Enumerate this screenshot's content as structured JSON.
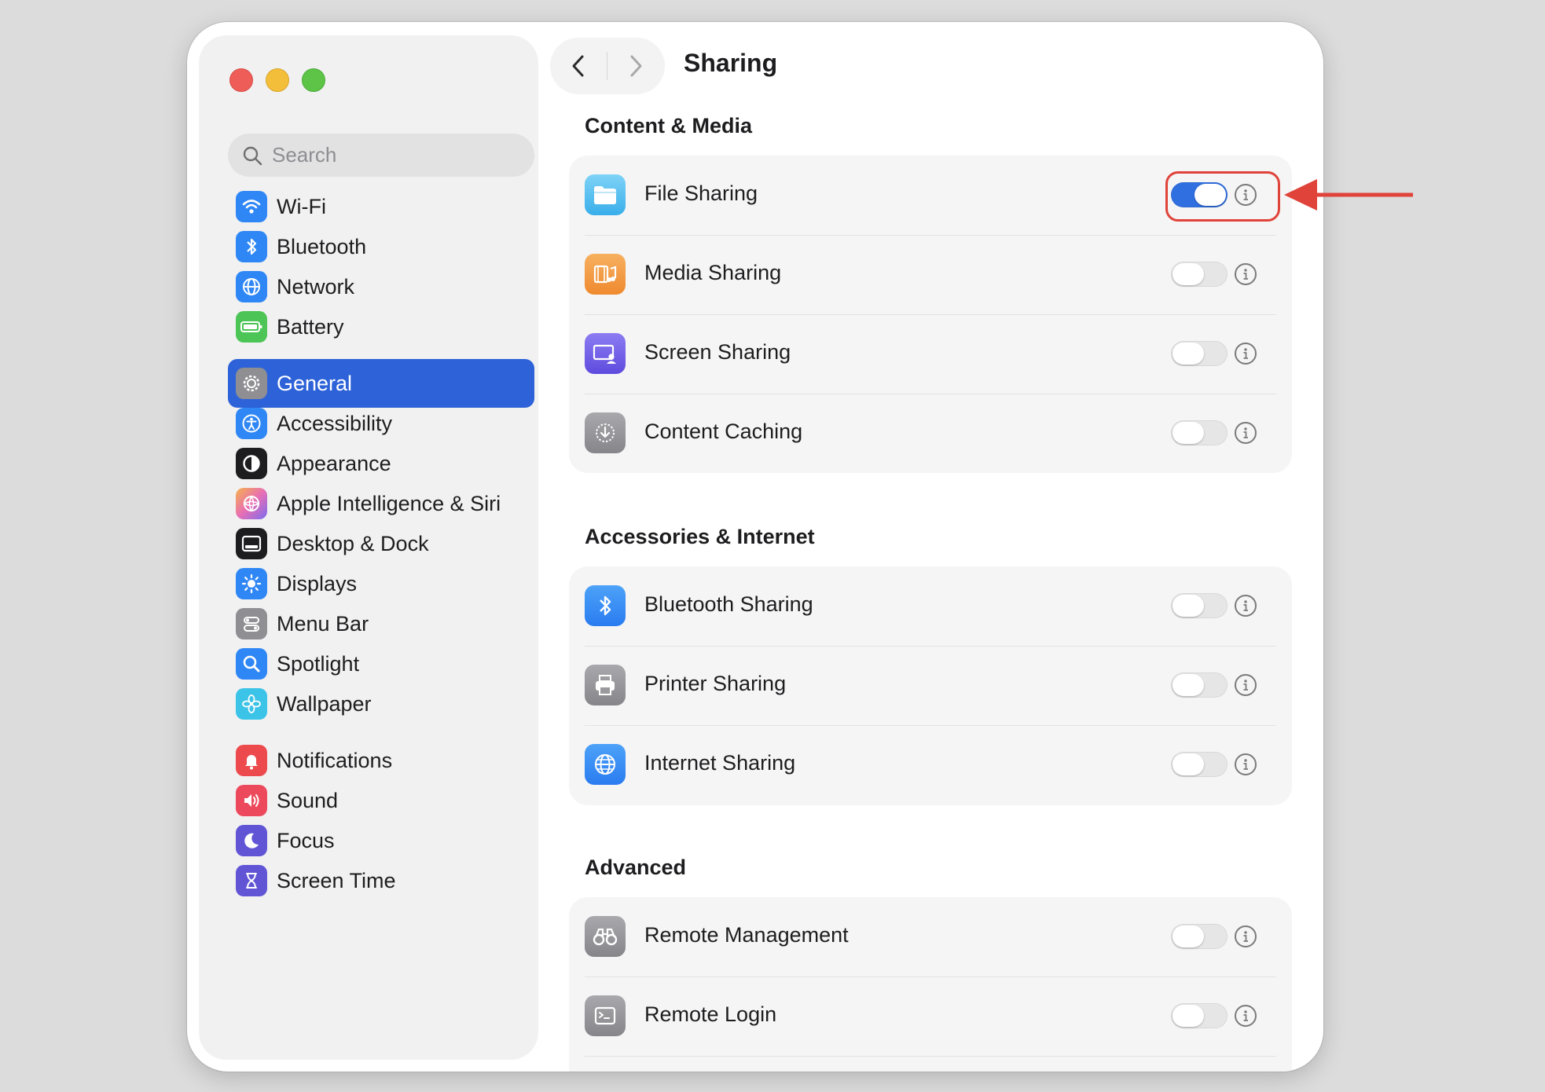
{
  "window": {
    "title": "Sharing"
  },
  "sidebar": {
    "search_placeholder": "Search",
    "items": [
      {
        "label": "Wi-Fi",
        "icon": "wifi-icon",
        "color": "#2f87f5"
      },
      {
        "label": "Bluetooth",
        "icon": "bluetooth-icon",
        "color": "#2f87f5"
      },
      {
        "label": "Network",
        "icon": "globe-icon",
        "color": "#2f87f5"
      },
      {
        "label": "Battery",
        "icon": "battery-icon",
        "color": "#4cc556"
      },
      {
        "label": "General",
        "icon": "gear-icon",
        "color": "#8e8e93",
        "selected": true
      },
      {
        "label": "Accessibility",
        "icon": "accessibility-icon",
        "color": "#2f87f5"
      },
      {
        "label": "Appearance",
        "icon": "appearance-icon",
        "color": "#1d1d1f"
      },
      {
        "label": "Apple Intelligence & Siri",
        "icon": "siri-icon",
        "color": "#e86fb4"
      },
      {
        "label": "Desktop & Dock",
        "icon": "dock-icon",
        "color": "#1d1d1f"
      },
      {
        "label": "Displays",
        "icon": "sun-icon",
        "color": "#2f87f5"
      },
      {
        "label": "Menu Bar",
        "icon": "menu-bar-icon",
        "color": "#8e8e93"
      },
      {
        "label": "Spotlight",
        "icon": "magnifier-icon",
        "color": "#2f87f5"
      },
      {
        "label": "Wallpaper",
        "icon": "flower-icon",
        "color": "#3bc3e8"
      },
      {
        "label": "Notifications",
        "icon": "bell-icon",
        "color": "#ec4a4d"
      },
      {
        "label": "Sound",
        "icon": "speaker-icon",
        "color": "#ec4a5c"
      },
      {
        "label": "Focus",
        "icon": "moon-icon",
        "color": "#6155d6"
      },
      {
        "label": "Screen Time",
        "icon": "hourglass-icon",
        "color": "#6155d6"
      }
    ]
  },
  "sections": [
    {
      "title": "Content & Media",
      "rows": [
        {
          "label": "File Sharing",
          "icon": "folder-icon",
          "enabled": true
        },
        {
          "label": "Media Sharing",
          "icon": "media-icon",
          "enabled": false
        },
        {
          "label": "Screen Sharing",
          "icon": "screen-sharing-icon",
          "enabled": false
        },
        {
          "label": "Content Caching",
          "icon": "download-icon",
          "enabled": false
        }
      ]
    },
    {
      "title": "Accessories & Internet",
      "rows": [
        {
          "label": "Bluetooth Sharing",
          "icon": "bluetooth-icon",
          "enabled": false
        },
        {
          "label": "Printer Sharing",
          "icon": "printer-icon",
          "enabled": false
        },
        {
          "label": "Internet Sharing",
          "icon": "globe-icon",
          "enabled": false
        }
      ]
    },
    {
      "title": "Advanced",
      "rows": [
        {
          "label": "Remote Management",
          "icon": "binoculars-icon",
          "enabled": false
        },
        {
          "label": "Remote Login",
          "icon": "terminal-icon",
          "enabled": false
        }
      ]
    }
  ],
  "annotation": {
    "highlight_color": "#e0433a"
  }
}
